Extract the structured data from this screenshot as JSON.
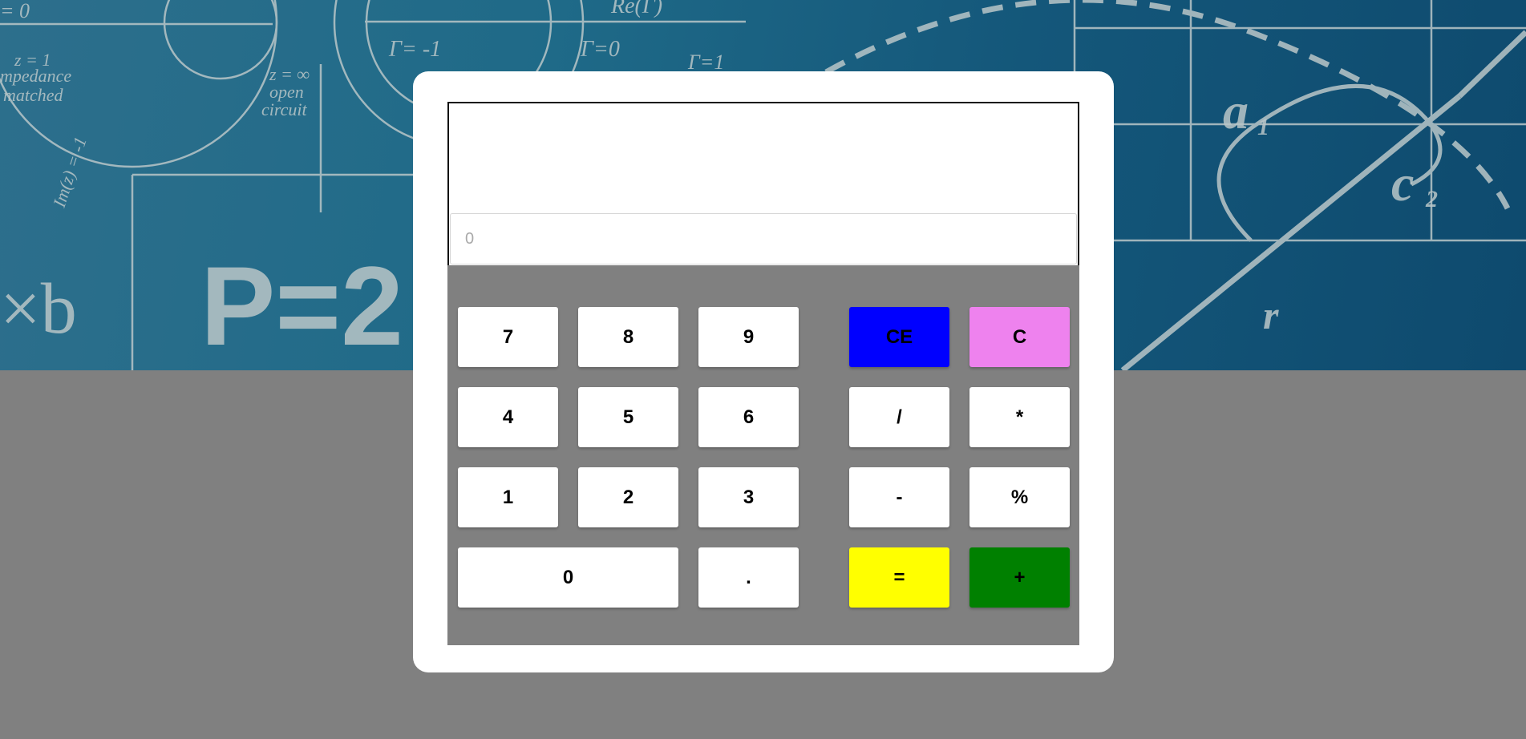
{
  "background": {
    "banner_texts": [
      "= 0",
      "z = 1",
      "mpedance",
      "matched",
      "Im(z) = -1",
      "z = ∞",
      "open",
      "circuit",
      "Γ= -1",
      "Γ=0",
      "Γ=1",
      "Re(Γ)",
      "×b",
      "P=2",
      "a",
      "1",
      "c",
      "2",
      "r"
    ]
  },
  "display": {
    "history": "",
    "entry_value": "",
    "entry_placeholder": "0"
  },
  "colors": {
    "clear_entry": "#0000ff",
    "clear": "#ee82ee",
    "equals": "#ffff00",
    "plus": "#008000"
  },
  "keypad": {
    "seven": "7",
    "eight": "8",
    "nine": "9",
    "four": "4",
    "five": "5",
    "six": "6",
    "one": "1",
    "two": "2",
    "three": "3",
    "zero": "0",
    "decimal": ".",
    "clear_entry": "CE",
    "clear": "C",
    "divide": "/",
    "multiply": "*",
    "subtract": "-",
    "percent": "%",
    "equals": "=",
    "add": "+"
  }
}
